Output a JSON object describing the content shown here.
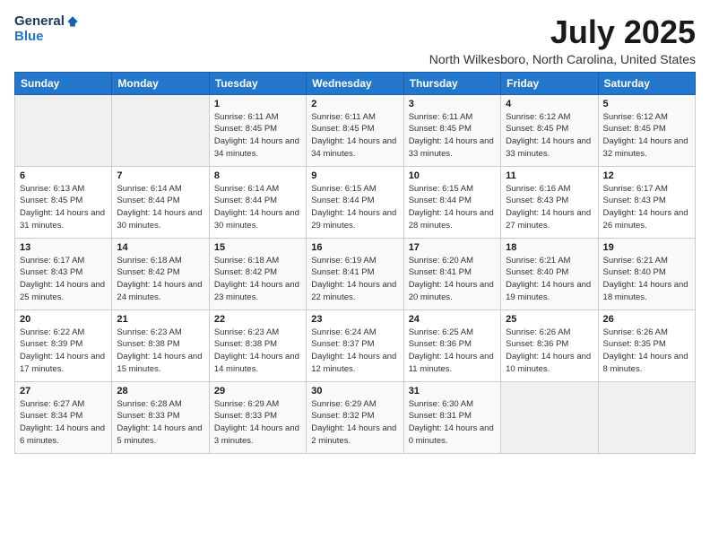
{
  "header": {
    "logo_general": "General",
    "logo_blue": "Blue",
    "month_year": "July 2025",
    "location": "North Wilkesboro, North Carolina, United States"
  },
  "days_of_week": [
    "Sunday",
    "Monday",
    "Tuesday",
    "Wednesday",
    "Thursday",
    "Friday",
    "Saturday"
  ],
  "weeks": [
    [
      {
        "day": "",
        "sunrise": "",
        "sunset": "",
        "daylight": ""
      },
      {
        "day": "",
        "sunrise": "",
        "sunset": "",
        "daylight": ""
      },
      {
        "day": "1",
        "sunrise": "Sunrise: 6:11 AM",
        "sunset": "Sunset: 8:45 PM",
        "daylight": "Daylight: 14 hours and 34 minutes."
      },
      {
        "day": "2",
        "sunrise": "Sunrise: 6:11 AM",
        "sunset": "Sunset: 8:45 PM",
        "daylight": "Daylight: 14 hours and 34 minutes."
      },
      {
        "day": "3",
        "sunrise": "Sunrise: 6:11 AM",
        "sunset": "Sunset: 8:45 PM",
        "daylight": "Daylight: 14 hours and 33 minutes."
      },
      {
        "day": "4",
        "sunrise": "Sunrise: 6:12 AM",
        "sunset": "Sunset: 8:45 PM",
        "daylight": "Daylight: 14 hours and 33 minutes."
      },
      {
        "day": "5",
        "sunrise": "Sunrise: 6:12 AM",
        "sunset": "Sunset: 8:45 PM",
        "daylight": "Daylight: 14 hours and 32 minutes."
      }
    ],
    [
      {
        "day": "6",
        "sunrise": "Sunrise: 6:13 AM",
        "sunset": "Sunset: 8:45 PM",
        "daylight": "Daylight: 14 hours and 31 minutes."
      },
      {
        "day": "7",
        "sunrise": "Sunrise: 6:14 AM",
        "sunset": "Sunset: 8:44 PM",
        "daylight": "Daylight: 14 hours and 30 minutes."
      },
      {
        "day": "8",
        "sunrise": "Sunrise: 6:14 AM",
        "sunset": "Sunset: 8:44 PM",
        "daylight": "Daylight: 14 hours and 30 minutes."
      },
      {
        "day": "9",
        "sunrise": "Sunrise: 6:15 AM",
        "sunset": "Sunset: 8:44 PM",
        "daylight": "Daylight: 14 hours and 29 minutes."
      },
      {
        "day": "10",
        "sunrise": "Sunrise: 6:15 AM",
        "sunset": "Sunset: 8:44 PM",
        "daylight": "Daylight: 14 hours and 28 minutes."
      },
      {
        "day": "11",
        "sunrise": "Sunrise: 6:16 AM",
        "sunset": "Sunset: 8:43 PM",
        "daylight": "Daylight: 14 hours and 27 minutes."
      },
      {
        "day": "12",
        "sunrise": "Sunrise: 6:17 AM",
        "sunset": "Sunset: 8:43 PM",
        "daylight": "Daylight: 14 hours and 26 minutes."
      }
    ],
    [
      {
        "day": "13",
        "sunrise": "Sunrise: 6:17 AM",
        "sunset": "Sunset: 8:43 PM",
        "daylight": "Daylight: 14 hours and 25 minutes."
      },
      {
        "day": "14",
        "sunrise": "Sunrise: 6:18 AM",
        "sunset": "Sunset: 8:42 PM",
        "daylight": "Daylight: 14 hours and 24 minutes."
      },
      {
        "day": "15",
        "sunrise": "Sunrise: 6:18 AM",
        "sunset": "Sunset: 8:42 PM",
        "daylight": "Daylight: 14 hours and 23 minutes."
      },
      {
        "day": "16",
        "sunrise": "Sunrise: 6:19 AM",
        "sunset": "Sunset: 8:41 PM",
        "daylight": "Daylight: 14 hours and 22 minutes."
      },
      {
        "day": "17",
        "sunrise": "Sunrise: 6:20 AM",
        "sunset": "Sunset: 8:41 PM",
        "daylight": "Daylight: 14 hours and 20 minutes."
      },
      {
        "day": "18",
        "sunrise": "Sunrise: 6:21 AM",
        "sunset": "Sunset: 8:40 PM",
        "daylight": "Daylight: 14 hours and 19 minutes."
      },
      {
        "day": "19",
        "sunrise": "Sunrise: 6:21 AM",
        "sunset": "Sunset: 8:40 PM",
        "daylight": "Daylight: 14 hours and 18 minutes."
      }
    ],
    [
      {
        "day": "20",
        "sunrise": "Sunrise: 6:22 AM",
        "sunset": "Sunset: 8:39 PM",
        "daylight": "Daylight: 14 hours and 17 minutes."
      },
      {
        "day": "21",
        "sunrise": "Sunrise: 6:23 AM",
        "sunset": "Sunset: 8:38 PM",
        "daylight": "Daylight: 14 hours and 15 minutes."
      },
      {
        "day": "22",
        "sunrise": "Sunrise: 6:23 AM",
        "sunset": "Sunset: 8:38 PM",
        "daylight": "Daylight: 14 hours and 14 minutes."
      },
      {
        "day": "23",
        "sunrise": "Sunrise: 6:24 AM",
        "sunset": "Sunset: 8:37 PM",
        "daylight": "Daylight: 14 hours and 12 minutes."
      },
      {
        "day": "24",
        "sunrise": "Sunrise: 6:25 AM",
        "sunset": "Sunset: 8:36 PM",
        "daylight": "Daylight: 14 hours and 11 minutes."
      },
      {
        "day": "25",
        "sunrise": "Sunrise: 6:26 AM",
        "sunset": "Sunset: 8:36 PM",
        "daylight": "Daylight: 14 hours and 10 minutes."
      },
      {
        "day": "26",
        "sunrise": "Sunrise: 6:26 AM",
        "sunset": "Sunset: 8:35 PM",
        "daylight": "Daylight: 14 hours and 8 minutes."
      }
    ],
    [
      {
        "day": "27",
        "sunrise": "Sunrise: 6:27 AM",
        "sunset": "Sunset: 8:34 PM",
        "daylight": "Daylight: 14 hours and 6 minutes."
      },
      {
        "day": "28",
        "sunrise": "Sunrise: 6:28 AM",
        "sunset": "Sunset: 8:33 PM",
        "daylight": "Daylight: 14 hours and 5 minutes."
      },
      {
        "day": "29",
        "sunrise": "Sunrise: 6:29 AM",
        "sunset": "Sunset: 8:33 PM",
        "daylight": "Daylight: 14 hours and 3 minutes."
      },
      {
        "day": "30",
        "sunrise": "Sunrise: 6:29 AM",
        "sunset": "Sunset: 8:32 PM",
        "daylight": "Daylight: 14 hours and 2 minutes."
      },
      {
        "day": "31",
        "sunrise": "Sunrise: 6:30 AM",
        "sunset": "Sunset: 8:31 PM",
        "daylight": "Daylight: 14 hours and 0 minutes."
      },
      {
        "day": "",
        "sunrise": "",
        "sunset": "",
        "daylight": ""
      },
      {
        "day": "",
        "sunrise": "",
        "sunset": "",
        "daylight": ""
      }
    ]
  ]
}
